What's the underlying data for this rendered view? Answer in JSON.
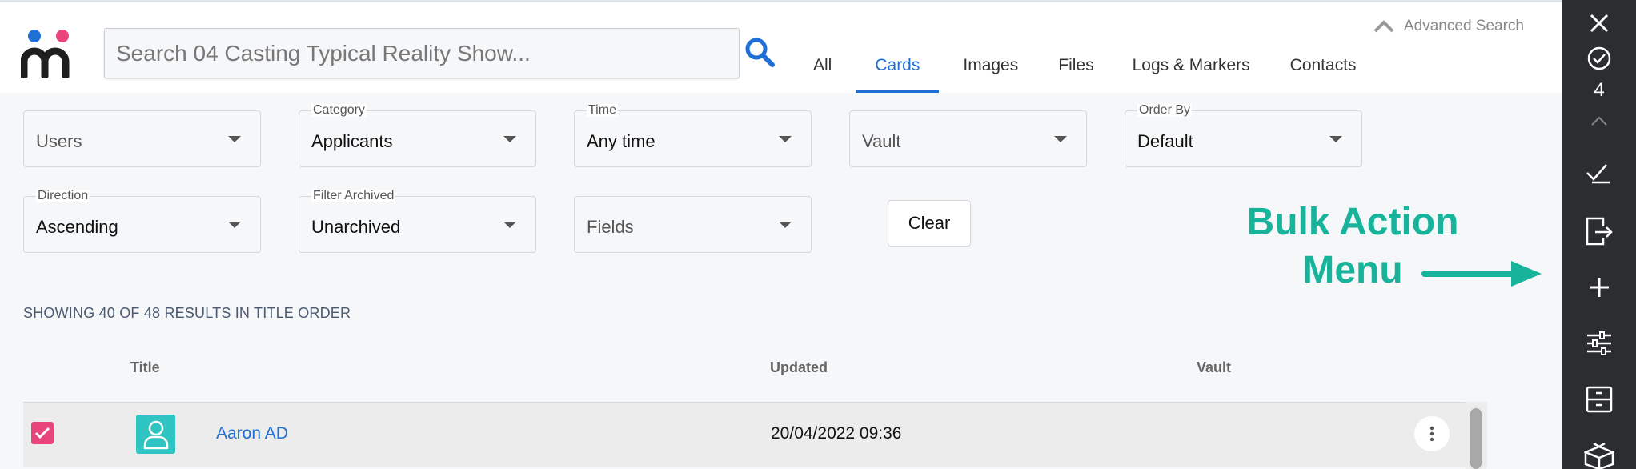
{
  "search": {
    "placeholder": "Search 04 Casting Typical Reality Show..."
  },
  "advanced_search_label": "Advanced Search",
  "tabs": [
    {
      "label": "All",
      "active": false
    },
    {
      "label": "Cards",
      "active": true
    },
    {
      "label": "Images",
      "active": false
    },
    {
      "label": "Files",
      "active": false
    },
    {
      "label": "Logs & Markers",
      "active": false
    },
    {
      "label": "Contacts",
      "active": false
    }
  ],
  "filters": {
    "users": {
      "label": "",
      "value": "Users"
    },
    "category": {
      "label": "Category",
      "value": "Applicants"
    },
    "time": {
      "label": "Time",
      "value": "Any time"
    },
    "vault": {
      "label": "",
      "value": "Vault"
    },
    "order_by": {
      "label": "Order By",
      "value": "Default"
    },
    "direction": {
      "label": "Direction",
      "value": "Ascending"
    },
    "filter_archived": {
      "label": "Filter Archived",
      "value": "Unarchived"
    },
    "fields": {
      "label": "",
      "value": "Fields"
    }
  },
  "clear_label": "Clear",
  "results_text": "SHOWING 40 OF 48 RESULTS IN TITLE ORDER",
  "table": {
    "columns": {
      "title": "Title",
      "updated": "Updated",
      "vault": "Vault"
    },
    "rows": [
      {
        "title": "Aaron AD",
        "updated": "20/04/2022 09:36",
        "vault": "",
        "checked": true
      }
    ]
  },
  "annotation": {
    "line1": "Bulk Action",
    "line2": "Menu"
  },
  "sidebar": {
    "selected_count": "4",
    "icons": [
      "close-icon",
      "check-circle-icon",
      "chevron-up-icon",
      "double-check-icon",
      "export-icon",
      "plus-icon",
      "sliders-icon",
      "archive-icon",
      "box-icon"
    ]
  },
  "colors": {
    "accent": "#1f6fd6",
    "checkbox": "#e8457d",
    "avatar": "#2ec4c1",
    "annotation": "#17b39a",
    "sidebar": "#2b2d30"
  }
}
